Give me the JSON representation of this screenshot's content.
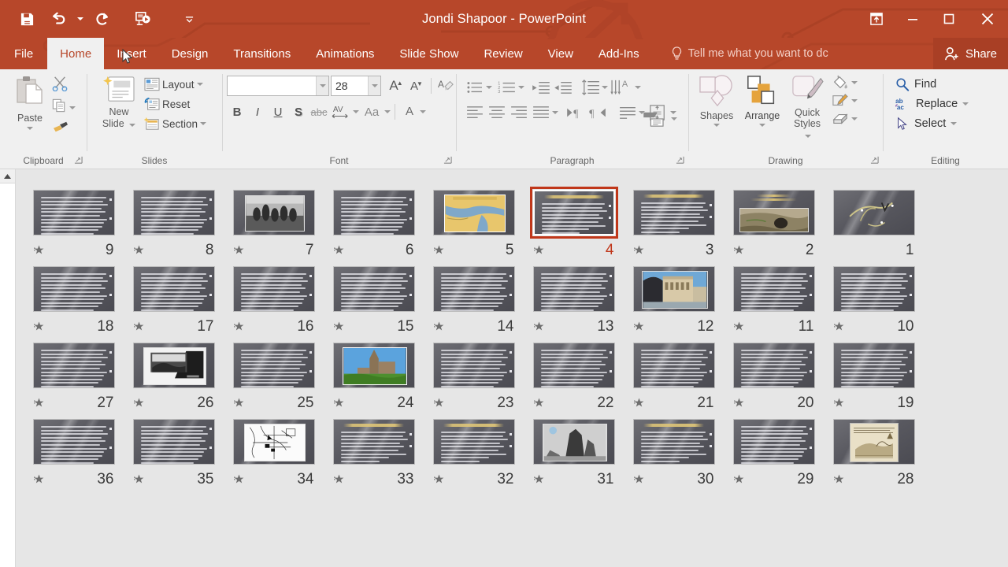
{
  "window": {
    "title": "Jondi Shapoor - PowerPoint",
    "accent_color": "#b7472a",
    "share_label": "Share",
    "tellme_placeholder": "Tell me what you want to dc"
  },
  "quick_access": [
    {
      "name": "save-icon",
      "label": "Save"
    },
    {
      "name": "undo-icon",
      "label": "Undo"
    },
    {
      "name": "redo-icon",
      "label": "Repeat"
    },
    {
      "name": "start-slideshow-icon",
      "label": "Start From Beginning"
    },
    {
      "name": "customize-qat-icon",
      "label": "Customize Quick Access Toolbar"
    }
  ],
  "window_controls": [
    {
      "name": "ribbon-display-options-icon",
      "label": "Ribbon Display Options"
    },
    {
      "name": "minimize-icon",
      "label": "Minimize"
    },
    {
      "name": "restore-icon",
      "label": "Restore Down"
    },
    {
      "name": "close-icon",
      "label": "Close"
    }
  ],
  "tabs": [
    {
      "label": "File",
      "active": false
    },
    {
      "label": "Home",
      "active": true
    },
    {
      "label": "Insert",
      "active": false
    },
    {
      "label": "Design",
      "active": false
    },
    {
      "label": "Transitions",
      "active": false
    },
    {
      "label": "Animations",
      "active": false
    },
    {
      "label": "Slide Show",
      "active": false
    },
    {
      "label": "Review",
      "active": false
    },
    {
      "label": "View",
      "active": false
    },
    {
      "label": "Add-Ins",
      "active": false
    }
  ],
  "ribbon": {
    "groups": [
      {
        "label": "Clipboard"
      },
      {
        "label": "Slides"
      },
      {
        "label": "Font"
      },
      {
        "label": "Paragraph"
      },
      {
        "label": "Drawing"
      },
      {
        "label": "Editing"
      }
    ],
    "clipboard": {
      "paste_label": "Paste",
      "cut_label": "Cut",
      "copy_label": "Copy",
      "format_painter_label": "Format Painter"
    },
    "slides": {
      "new_slide_line1": "New",
      "new_slide_line2": "Slide",
      "layout_label": "Layout",
      "reset_label": "Reset",
      "section_label": "Section"
    },
    "font": {
      "font_name_value": "",
      "font_size_value": "28",
      "grow_font_label": "A",
      "shrink_font_label": "A",
      "clear_formatting_label": "A",
      "bold_label": "B",
      "italic_label": "I",
      "underline_label": "U",
      "shadow_label": "S",
      "strikethrough_label": "abc",
      "spacing_label": "AV",
      "change_case_label": "Aa",
      "font_color_label": "A"
    },
    "drawing": {
      "shapes_label": "Shapes",
      "arrange_label": "Arrange",
      "quick_styles_line1": "Quick",
      "quick_styles_line2": "Styles",
      "shape_fill_label": "Shape Fill",
      "shape_outline_label": "Shape Outline",
      "shape_effects_label": "Shape Effects"
    },
    "editing": {
      "find_label": "Find",
      "replace_label": "Replace",
      "select_label": "Select"
    }
  },
  "slide_sorter": {
    "selected_slide": 4,
    "rows": [
      [
        {
          "number": "9",
          "kind": "text",
          "star": true
        },
        {
          "number": "8",
          "kind": "text",
          "star": true
        },
        {
          "number": "7",
          "kind": "photo-bw-crowd",
          "star": true
        },
        {
          "number": "6",
          "kind": "text",
          "star": true
        },
        {
          "number": "5",
          "kind": "photo-map-color",
          "star": true
        },
        {
          "number": "4",
          "kind": "text-titled",
          "star": true,
          "selected": true
        },
        {
          "number": "3",
          "kind": "text-titled",
          "star": true
        },
        {
          "number": "2",
          "kind": "photo-wood",
          "star": true
        },
        {
          "number": "1",
          "kind": "title-calligraphy",
          "star": false
        }
      ],
      [
        {
          "number": "18",
          "kind": "text",
          "star": true
        },
        {
          "number": "17",
          "kind": "text",
          "star": true
        },
        {
          "number": "16",
          "kind": "text",
          "star": true
        },
        {
          "number": "15",
          "kind": "text",
          "star": true
        },
        {
          "number": "14",
          "kind": "text",
          "star": true
        },
        {
          "number": "13",
          "kind": "text",
          "star": true
        },
        {
          "number": "12",
          "kind": "photo-arch-blue",
          "star": true
        },
        {
          "number": "11",
          "kind": "text",
          "star": true
        },
        {
          "number": "10",
          "kind": "text",
          "star": true
        }
      ],
      [
        {
          "number": "27",
          "kind": "text",
          "star": true
        },
        {
          "number": "26",
          "kind": "photo-bw-doc",
          "star": true
        },
        {
          "number": "25",
          "kind": "text",
          "star": true
        },
        {
          "number": "24",
          "kind": "photo-tower-green",
          "star": true
        },
        {
          "number": "23",
          "kind": "text",
          "star": true
        },
        {
          "number": "22",
          "kind": "text",
          "star": true
        },
        {
          "number": "21",
          "kind": "text",
          "star": true
        },
        {
          "number": "20",
          "kind": "text",
          "star": true
        },
        {
          "number": "19",
          "kind": "text",
          "star": true
        }
      ],
      [
        {
          "number": "36",
          "kind": "text",
          "star": true
        },
        {
          "number": "35",
          "kind": "text",
          "star": true
        },
        {
          "number": "34",
          "kind": "photo-line-map",
          "star": true
        },
        {
          "number": "33",
          "kind": "text-titled",
          "star": true
        },
        {
          "number": "32",
          "kind": "text-titled",
          "star": true
        },
        {
          "number": "31",
          "kind": "photo-bw-rock",
          "star": true
        },
        {
          "number": "30",
          "kind": "text-titled",
          "star": true
        },
        {
          "number": "29",
          "kind": "text",
          "star": true
        },
        {
          "number": "28",
          "kind": "photo-sepia-engraving",
          "star": true
        }
      ]
    ]
  }
}
